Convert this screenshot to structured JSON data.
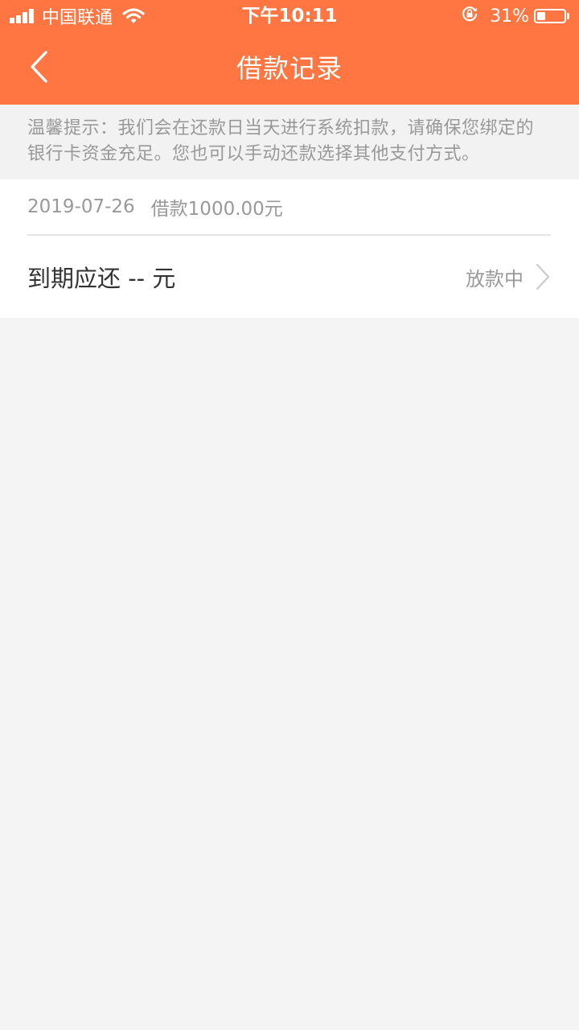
{
  "status_bar": {
    "carrier": "中国联通",
    "time": "下午10:11",
    "battery_percent": "31%",
    "battery_level": 0.31,
    "icons": [
      "signal-icon",
      "wifi-icon",
      "rotation-lock-icon",
      "battery-icon"
    ]
  },
  "header": {
    "title": "借款记录",
    "back_icon": "chevron-left-icon",
    "background": "#ff7642"
  },
  "notice": {
    "text": "温馨提示：我们会在还款日当天进行系统扣款，请确保您绑定的银行卡资金充足。您也可以手动还款选择其他支付方式。"
  },
  "records": [
    {
      "date": "2019-07-26",
      "loan": "借款1000.00元",
      "due_label": "到期应还 -- 元",
      "status": "放款中",
      "arrow_icon": "chevron-right-icon"
    }
  ]
}
